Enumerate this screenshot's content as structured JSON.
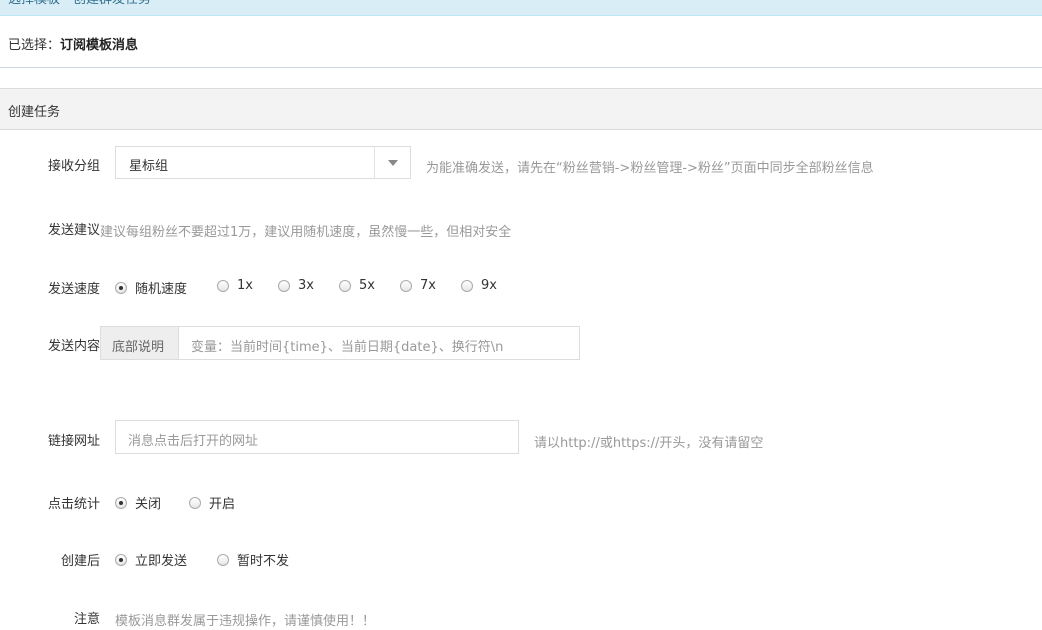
{
  "topbar": {
    "text": "选择模板 - 创建群发任务"
  },
  "selected": {
    "label": "已选择：",
    "value": "订阅模板消息"
  },
  "section": {
    "title": "创建任务"
  },
  "group": {
    "label": "接收分组",
    "value": "星标组",
    "hint": "为能准确发送，请先在“粉丝营销->粉丝管理->粉丝”页面中同步全部粉丝信息"
  },
  "suggest": {
    "label": "发送建议",
    "text": "建议每组粉丝不要超过1万，建议用随机速度，虽然慢一些，但相对安全"
  },
  "speed": {
    "label": "发送速度",
    "options": [
      "随机速度",
      "1x",
      "3x",
      "5x",
      "7x",
      "9x"
    ],
    "selected": "随机速度"
  },
  "content": {
    "label": "发送内容",
    "addon": "底部说明",
    "placeholder": "变量：当前时间{time}、当前日期{date}、换行符\\n"
  },
  "link": {
    "label": "链接网址",
    "placeholder": "消息点击后打开的网址",
    "hint": "请以http://或https://开头，没有请留空"
  },
  "stats": {
    "label": "点击统计",
    "options": [
      "关闭",
      "开启"
    ],
    "selected": "关闭"
  },
  "after": {
    "label": "创建后",
    "options": [
      "立即发送",
      "暂时不发"
    ],
    "selected": "立即发送"
  },
  "notice": {
    "label": "注意",
    "text": "模板消息群发属于违规操作，请谨慎使用！！"
  }
}
